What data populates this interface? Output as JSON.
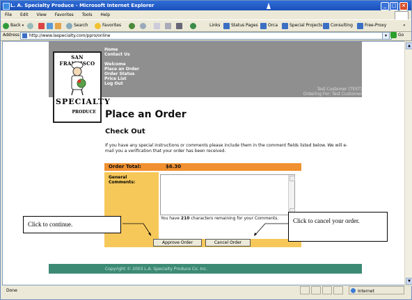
{
  "window": {
    "title": "L. A. Specialty Produce - Microsoft Internet Explorer",
    "buttons": [
      "_",
      "□",
      "×"
    ]
  },
  "menu": [
    "File",
    "Edit",
    "View",
    "Favorites",
    "Tools",
    "Help"
  ],
  "toolbar": {
    "back": "Back",
    "search": "Search",
    "favorites": "Favorites",
    "links_label": "Links",
    "links": [
      "Status Pages",
      "Orca",
      "Special Projects",
      "Consulting",
      "Free-Proxy"
    ],
    "more": "»"
  },
  "address": {
    "label": "Address",
    "url": "http://www.laspecialty.com/ppro/online",
    "go": "Go"
  },
  "logo": {
    "line1": "SAN FRANCISCO",
    "line2": "SPECIALTY",
    "line3": "PRODUCE"
  },
  "nav": {
    "home": "Home",
    "contact": "Contact Us",
    "welcome": "Welcome",
    "place_order": "Place an Order",
    "order_status": "Order Status",
    "price_list": "Price List",
    "log_out": "Log Out"
  },
  "customer": {
    "name": "Test Customer (TEST)",
    "ordering_for": "Ordering For: Test Customer"
  },
  "page": {
    "title": "Place an Order",
    "subtitle": "Check Out",
    "instructions": "If you have any special instructions or comments please include them in the comment fields listed below. We will e-mail you a verification that your order has been received."
  },
  "order": {
    "total_label": "Order Total:",
    "total_value": "$6.30",
    "comments_label_1": "General",
    "comments_label_2": "Comments:",
    "remaining_prefix": "You have",
    "remaining_count": "210",
    "remaining_suffix": "characters remaining for your Comments.",
    "approve_label": "Approve Order",
    "cancel_label": "Cancel Order"
  },
  "footer": {
    "copyright": "Copyright © 2003 L.A. Specialty Produce Co. Inc."
  },
  "callouts": {
    "continue": "Click to continue.",
    "cancel": "Click to cancel your order."
  },
  "status": {
    "left": "Done",
    "zone": "Internet"
  },
  "colors": {
    "header_gray": "#8f8f8f",
    "total_orange": "#f09030",
    "label_yellow": "#f6c85a",
    "footer_green": "#3c8a74"
  }
}
